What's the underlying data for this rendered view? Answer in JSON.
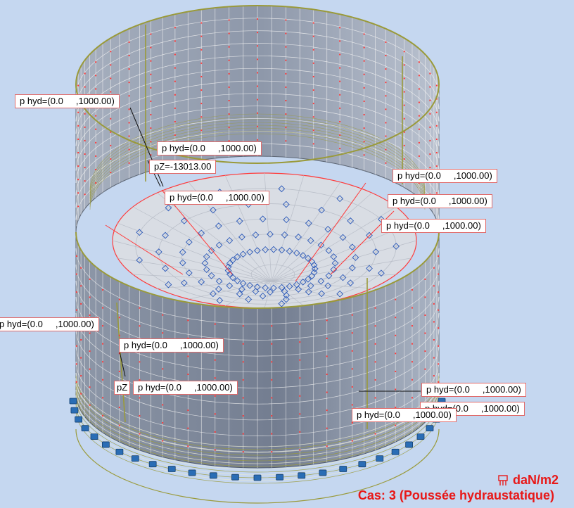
{
  "viewport": {
    "background": "#c5d7f0",
    "load_labels": [
      {
        "id": "l1",
        "text": "p hyd=(0.0     ,1000.00)"
      },
      {
        "id": "l2",
        "text": "p hyd=(0.0     ,1000.00)"
      },
      {
        "id": "l3",
        "text": "pZ=-13013.00"
      },
      {
        "id": "l4",
        "text": "p hyd=(0.0     ,1000.00)"
      },
      {
        "id": "l5",
        "text": "p hyd=(0.0     ,1000.00)"
      },
      {
        "id": "l6",
        "text": "p hyd=(0.0     ,1000.00)"
      },
      {
        "id": "l7",
        "text": "p hyd=(0.0     ,1000.00)"
      },
      {
        "id": "l8",
        "text": "p hyd=(0.0     ,1000.00)"
      },
      {
        "id": "l9",
        "text": "p hyd=(0.0     ,1000.00)"
      },
      {
        "id": "l10",
        "text": "pZ"
      },
      {
        "id": "l11",
        "text": "p hyd=(0.0     ,1000.00)"
      },
      {
        "id": "l12",
        "text": "p hyd=(0.0     ,1000.00)"
      },
      {
        "id": "l13",
        "text": "p hyd=(0.0     ,1000.00)"
      },
      {
        "id": "l14",
        "text": "p hyd=(0.0     ,1000.00)"
      }
    ]
  },
  "legend": {
    "unit": "daN/m2",
    "case": "Cas: 3 (Poussée hydraustatique)",
    "icon": "load-icon",
    "color": "#e81818"
  },
  "colors": {
    "shell_dark": "#7c8799",
    "shell_light": "#aeb8c8",
    "mesh": "#f2f2f2",
    "edge": "#9a9a3a",
    "load": "#ff3a3a",
    "support": "#2a6db5"
  }
}
